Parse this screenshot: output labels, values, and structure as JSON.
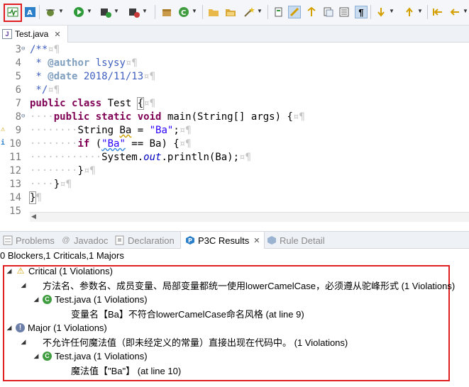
{
  "toolbar": {
    "icons": [
      "p3c-scan-icon",
      "a-plus-icon",
      "debug-icon",
      "run-icon",
      "coverage-icon",
      "external-tools-icon",
      "new-package-icon",
      "new-class-icon",
      "open-folder-icon",
      "open-folder-2-icon",
      "wand-icon",
      "task-icon",
      "highlighter-icon",
      "format-icon",
      "doc-icon",
      "pilcrow-icon",
      "next-annotation-icon",
      "prev-annotation-icon",
      "back-icon",
      "forward-icon"
    ]
  },
  "editor": {
    "tab_label": "Test.java",
    "lines": [
      {
        "num": "3"
      },
      {
        "num": "4"
      },
      {
        "num": "5"
      },
      {
        "num": "6"
      },
      {
        "num": "7"
      },
      {
        "num": "8"
      },
      {
        "num": "9"
      },
      {
        "num": "10"
      },
      {
        "num": "11"
      },
      {
        "num": "12"
      },
      {
        "num": "13"
      },
      {
        "num": "14"
      },
      {
        "num": "15"
      }
    ],
    "code": {
      "l3": "/**",
      "l4_tag": "@author",
      "l4_val": " lsysy",
      "l5_tag": "@date",
      "l5_val": " 2018/11/13",
      "l6": " */",
      "l7_kw1": "public",
      "l7_kw2": "class",
      "l7_name": " Test ",
      "l8_kw1": "public",
      "l8_kw2": "static",
      "l8_kw3": "void",
      "l8_rest": " main(String[] args) {",
      "l9_type": "String ",
      "l9_var": "Ba",
      "l9_eq": " = ",
      "l9_str": "\"Ba\"",
      "l9_end": ";",
      "l10_kw": "if",
      "l10_open": " (",
      "l10_str": "\"Ba\"",
      "l10_rest": " == Ba) {",
      "l11_pre": "System.",
      "l11_out": "out",
      "l11_rest": ".println(Ba);",
      "l12": "}",
      "l13": "}",
      "l14": "}"
    }
  },
  "panel": {
    "tabs": [
      {
        "label": "Problems"
      },
      {
        "label": "Javadoc"
      },
      {
        "label": "Declaration"
      },
      {
        "label": "P3C Results"
      },
      {
        "label": "Rule Detail"
      }
    ],
    "summary": "0 Blockers,1 Criticals,1 Majors",
    "tree": {
      "critical_label": "Critical (1 Violations)",
      "critical_rule": "方法名、参数名、成员变量、局部变量都统一使用lowerCamelCase，必须遵从驼峰形式 (1 Violations)",
      "critical_file": "Test.java (1 Violations)",
      "critical_detail": "变量名【Ba】不符合lowerCamelCase命名风格 (at line 9)",
      "major_label": "Major (1 Violations)",
      "major_rule": "不允许任何魔法值（即未经定义的常量）直接出现在代码中。 (1 Violations)",
      "major_file": "Test.java (1 Violations)",
      "major_detail": "魔法值【\"Ba\"】 (at line 10)"
    }
  },
  "colors": {
    "highlight_border": "#e02020",
    "keyword": "#7f0055",
    "comment": "#3f5fbf",
    "string": "#2a00ff"
  }
}
